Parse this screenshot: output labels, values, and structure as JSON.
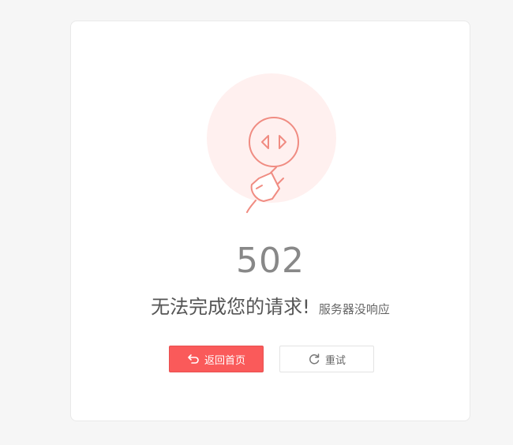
{
  "error": {
    "code": "502",
    "message": "无法完成您的请求!",
    "detail": "服务器没响应"
  },
  "actions": {
    "home_label": "返回首页",
    "retry_label": "重试"
  },
  "icons": {
    "illustration": "unplugged-socket-icon",
    "home": "return-arrow-icon",
    "retry": "refresh-icon"
  },
  "colors": {
    "accent": "#fa5a5a",
    "illustration_bg": "#fff0ef",
    "illustration_stroke": "#f08c82",
    "code_text": "#888888"
  }
}
